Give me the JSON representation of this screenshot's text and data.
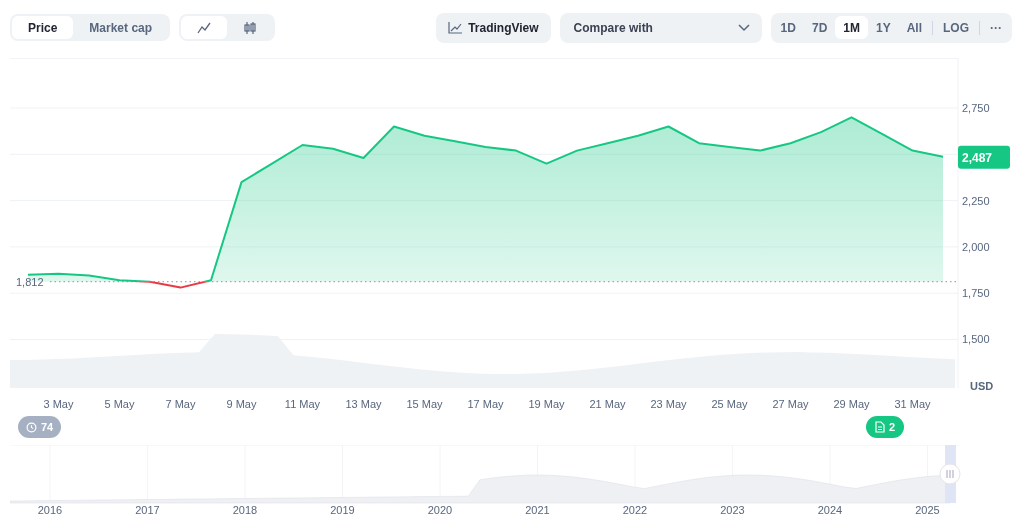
{
  "toolbar": {
    "metric_tabs": [
      {
        "label": "Price",
        "selected": true
      },
      {
        "label": "Market cap",
        "selected": false
      }
    ],
    "chart_type_tabs": [
      {
        "kind": "line",
        "selected": true
      },
      {
        "kind": "candles",
        "selected": false
      }
    ],
    "tradingview_button": "TradingView",
    "compare_dropdown": {
      "placeholder": "Compare with"
    },
    "ranges": [
      {
        "label": "1D",
        "selected": false
      },
      {
        "label": "7D",
        "selected": false
      },
      {
        "label": "1M",
        "selected": true
      },
      {
        "label": "1Y",
        "selected": false
      },
      {
        "label": "All",
        "selected": false
      }
    ],
    "log_button": "LOG",
    "more_button": "···"
  },
  "chart": {
    "current_price": "2,487",
    "currency": "USD",
    "chart_data": {
      "type": "area",
      "grid": true,
      "ref_lines": [
        {
          "axis": "y",
          "value": 1812,
          "label": "1,812"
        }
      ],
      "categories": [
        null,
        "3 May",
        null,
        "5 May",
        null,
        "7 May",
        null,
        "9 May",
        null,
        "11 May",
        null,
        "13 May",
        null,
        "15 May",
        null,
        "17 May",
        null,
        "19 May",
        null,
        "21 May",
        null,
        "23 May",
        null,
        "25 May",
        null,
        "27 May",
        null,
        "29 May",
        null,
        "31 May",
        null
      ],
      "series": [
        {
          "color": "#16c784",
          "values": [
            1850,
            1855,
            1845,
            1820,
            1812,
            1780,
            1820,
            2350,
            2450,
            2550,
            2530,
            2480,
            2650,
            2600,
            2570,
            2540,
            2520,
            2450,
            2520,
            2560,
            2600,
            2650,
            2560,
            2540,
            2520,
            2560,
            2620,
            2700,
            2610,
            2520,
            2487
          ]
        }
      ],
      "ylim": [
        1238,
        3020
      ],
      "yticks": [
        {
          "value": 1500,
          "label": "1,500"
        },
        {
          "value": 1750,
          "label": "1,750"
        },
        {
          "value": 2000,
          "label": "2,000"
        },
        {
          "value": 2250,
          "label": "2,250"
        },
        {
          "value": 2750,
          "label": "2,750"
        }
      ]
    }
  },
  "events": {
    "history_count": "74",
    "news_count": "2"
  },
  "navigator": {
    "years": [
      "2016",
      "2017",
      "2018",
      "2019",
      "2020",
      "2021",
      "2022",
      "2023",
      "2024",
      "2025"
    ]
  }
}
